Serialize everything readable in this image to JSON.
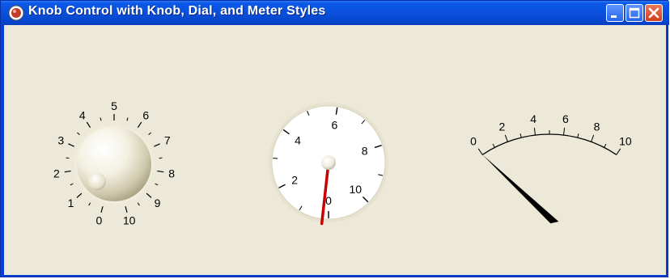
{
  "window": {
    "title": "Knob Control with Knob, Dial, and Meter Styles",
    "colors": {
      "titlebar": "#0a4fdc",
      "client": "#ece9d8",
      "close_button": "#d1401c"
    }
  },
  "knob": {
    "style": "Knob",
    "scale_labels": [
      "0",
      "1",
      "2",
      "3",
      "4",
      "5",
      "6",
      "7",
      "8",
      "9",
      "10"
    ],
    "value": 0.9
  },
  "dial": {
    "style": "Dial",
    "scale_labels": [
      "0",
      "2",
      "4",
      "6",
      "8",
      "10"
    ],
    "value": 0.2,
    "needle_color": "#cc0000"
  },
  "meter": {
    "style": "Meter",
    "scale_labels": [
      "0",
      "2",
      "4",
      "6",
      "8",
      "10"
    ],
    "value": -2.3,
    "needle_color": "#000000"
  }
}
